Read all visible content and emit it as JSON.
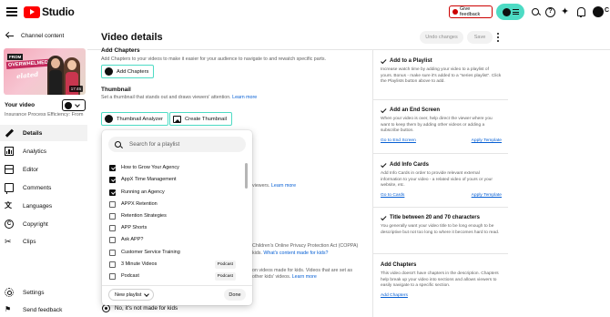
{
  "topbar": {
    "logo_text": "Studio",
    "feedback_label": "Give feedback",
    "help_glyph": "?",
    "spark_glyph": "✦",
    "cut_letter": "C",
    "icons": [
      "menu-icon",
      "search-icon",
      "help-icon",
      "sparkle-icon",
      "bell-icon",
      "avatar"
    ]
  },
  "sidebar": {
    "back_label": "Channel content",
    "thumb": {
      "line1": "FROM",
      "line2": "OVERWHELMED TO",
      "line3": "elated",
      "duration": "17:45"
    },
    "your_video_label": "Your video",
    "video_title": "Insurance Process Efficiency: From ...",
    "nav": [
      {
        "label": "Details",
        "icon": "pencil-icon",
        "active": true
      },
      {
        "label": "Analytics",
        "icon": "analytics-icon",
        "active": false
      },
      {
        "label": "Editor",
        "icon": "editor-icon",
        "active": false
      },
      {
        "label": "Comments",
        "icon": "comments-icon",
        "active": false
      },
      {
        "label": "Languages",
        "icon": "languages-icon",
        "active": false
      },
      {
        "label": "Copyright",
        "icon": "copyright-icon",
        "active": false
      },
      {
        "label": "Clips",
        "icon": "clips-icon",
        "active": false
      }
    ],
    "bottom_nav": [
      {
        "label": "Settings",
        "icon": "gear-icon"
      },
      {
        "label": "Send feedback",
        "icon": "feedback-icon"
      }
    ],
    "lang_glyph": "文",
    "copy_glyph": "C",
    "clips_glyph": "✂",
    "flag_glyph": "⚑"
  },
  "header": {
    "title": "Video details",
    "undo_label": "Undo changes",
    "save_label": "Save"
  },
  "chapters": {
    "heading": "Add Chapters",
    "text": "Add Chapters to your videos to make it easier for your audience to navigate to and rewatch specific parts.",
    "button_label": "Add Chapters"
  },
  "thumbnail": {
    "heading": "Thumbnail",
    "text": "Set a thumbnail that stands out and draws viewers' attention.",
    "learn_more": "Learn more",
    "analyzer_label": "Thumbnail Analyzer",
    "create_label": "Create Thumbnail"
  },
  "background_fragments": {
    "viewers": "viewers.",
    "learn_more_1": "Learn more",
    "coppa": "Children's Online Privacy Protection Act (COPPA)",
    "made_for_kids_pre": "kids.",
    "made_for_kids_link": "What's content made for kids?",
    "kids_line1": "on videos made for kids. Videos that are set as",
    "kids_line2": "other kids' videos.",
    "learn_more_2": "Learn more"
  },
  "audience": {
    "not_for_kids_label": "No, it's not made for kids"
  },
  "playlist_popup": {
    "search_placeholder": "Search for a playlist",
    "items": [
      {
        "label": "How to Grow Your Agency",
        "checked": true,
        "badge": ""
      },
      {
        "label": "AppX Time Management",
        "checked": true,
        "badge": ""
      },
      {
        "label": "Running an Agency",
        "checked": true,
        "badge": ""
      },
      {
        "label": "APPX Retention",
        "checked": false,
        "badge": ""
      },
      {
        "label": "Retention Strategies",
        "checked": false,
        "badge": ""
      },
      {
        "label": "APP Shorts",
        "checked": false,
        "badge": ""
      },
      {
        "label": "Ask APP?",
        "checked": false,
        "badge": ""
      },
      {
        "label": "Customer Service Training",
        "checked": false,
        "badge": ""
      },
      {
        "label": "3 Minute Videos",
        "checked": false,
        "badge": "Podcast"
      },
      {
        "label": "Podcast",
        "checked": false,
        "badge": "Podcast"
      }
    ],
    "new_playlist_label": "New playlist",
    "done_label": "Done"
  },
  "right_panel": {
    "cards": [
      {
        "title": "Add to a Playlist",
        "body": "Increase watch time by adding your video to a playlist of yours. Bonus - make sure it's added to a \"series playlist\". Click the Playlists button above to add.",
        "link_left": "",
        "link_right": ""
      },
      {
        "title": "Add an End Screen",
        "body": "When your video is over, help direct the viewer where you want to keep them by adding other videos or adding a subscribe button.",
        "link_left": "Go to End Screen",
        "link_right": "Apply Template"
      },
      {
        "title": "Add Info Cards",
        "body": "Add Info Cards in order to provide relevant external information to your video - a related video of yours or your website, etc.",
        "link_left": "Go to Cards",
        "link_right": "Apply Template"
      },
      {
        "title": "Title between 20 and 70 characters",
        "body": "You generally want your video title to be long enough to be descriptive but not too long to where it becomes hard to read.",
        "link_left": "",
        "link_right": ""
      }
    ],
    "chapters_card": {
      "title": "Add Chapters",
      "body": "This video doesn't have chapters in the description. Chapters help break up your video into sections and allows viewers to easily navigate to a specific section.",
      "link": "Add Chapters"
    }
  },
  "colors": {
    "accent_teal": "#4ddbc4",
    "brand_red": "#ff0000",
    "link_blue": "#065fd4"
  }
}
